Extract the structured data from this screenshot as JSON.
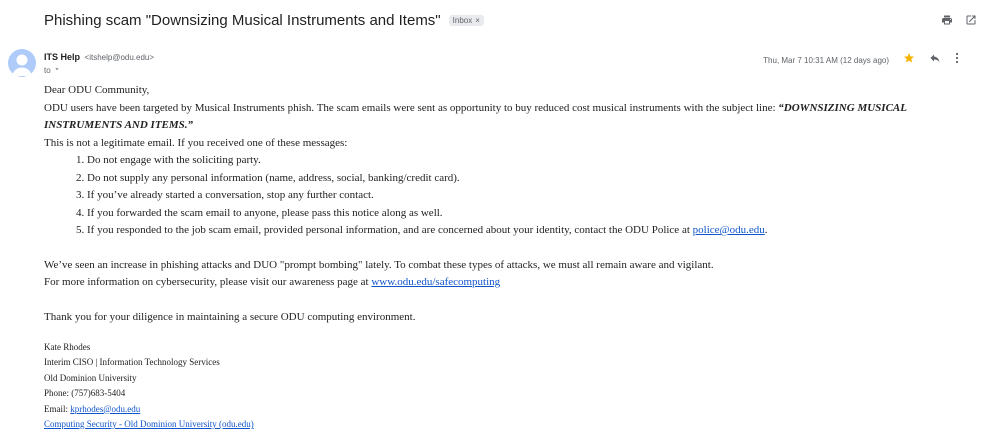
{
  "email": {
    "subject": "Phishing scam \"Downsizing Musical Instruments and Items\"",
    "label_chip": "Inbox",
    "label_chip_close": "×",
    "sender_name": "ITS Help",
    "sender_email": "<itshelp@odu.edu>",
    "to_label": "to",
    "date": "Thu, Mar 7 10:31 AM (12 days ago)"
  },
  "icons": {
    "print": "print-icon",
    "open_new_window": "open-in-new-window-icon",
    "star": "star-icon",
    "reply": "reply-icon",
    "more": "more-vert-icon",
    "avatar": "avatar-icon",
    "chevron": "chevron-down-icon"
  },
  "colors": {
    "star": "#f4b400",
    "link": "#1155cc",
    "avatar_bg": "#aecbfa"
  },
  "body": {
    "greeting": "Dear ODU Community,",
    "intro_text": "ODU users have been targeted by Musical Instruments phish. The scam emails were sent as opportunity to buy reduced cost musical instruments with the subject line: ",
    "intro_quote": "“DOWNSIZING MUSICAL INSTRUMENTS AND ITEMS.”",
    "not_legit": "This is not a legitimate email.  If you received one of these messages:",
    "steps": [
      "Do not engage with the soliciting party.",
      "Do not supply any personal information (name, address, social, banking/credit card).",
      "If you’ve already started a conversation, stop any further contact.",
      "If you forwarded the scam email to anyone, please pass this notice along as well."
    ],
    "step5_text": "If you responded to the job scam email, provided personal information, and are concerned about your identity, contact the ODU Police at ",
    "step5_link": "police@odu.edu",
    "step5_end": ".",
    "increase": "We’ve seen an increase in phishing attacks and DUO \"prompt bombing\" lately. To combat these types of attacks, we must all remain aware and vigilant.",
    "more_info": "For more information on cybersecurity, please visit our awareness page at ",
    "more_info_link": "www.odu.edu/safecomputing",
    "thanks": "Thank you for your diligence in maintaining a secure ODU computing environment."
  },
  "signature": {
    "name": "Kate Rhodes",
    "title": "Interim CISO | Information Technology Services",
    "org": "Old Dominion University",
    "phone": "Phone: (757)683-5404",
    "email_label": "Email: ",
    "email_link": "kprhodes@odu.edu",
    "site_link": "Computing Security - Old Dominion University (odu.edu)"
  }
}
